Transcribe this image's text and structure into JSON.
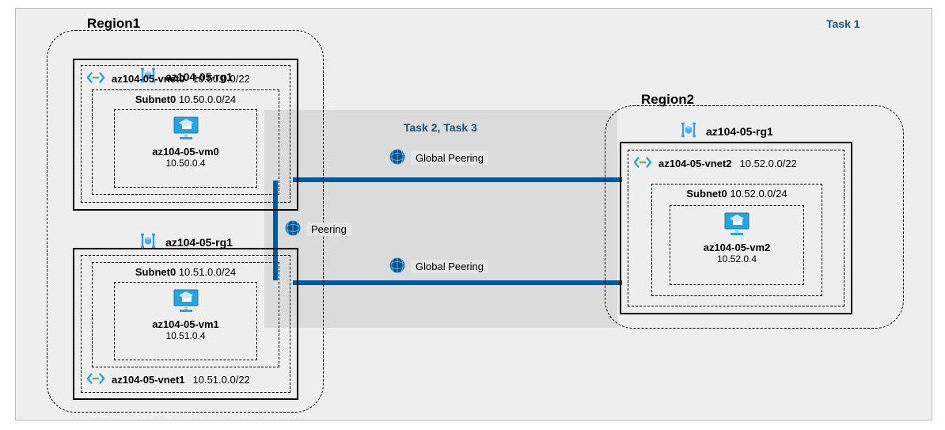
{
  "tasks": {
    "task1": "Task 1",
    "task23": "Task 2, Task 3"
  },
  "regions": {
    "r1": "Region1",
    "r2": "Region2"
  },
  "peering": {
    "local": "Peering",
    "global": "Global Peering"
  },
  "region1": {
    "rg_a": {
      "name": "az104-05-rg1",
      "vnet": {
        "name": "az104-05-vnet0",
        "cidr": "10.50.0.0/22"
      },
      "subnet": {
        "name": "Subnet0",
        "cidr": "10.50.0.0/24"
      },
      "vm": {
        "name": "az104-05-vm0",
        "ip": "10.50.0.4"
      }
    },
    "rg_b": {
      "name": "az104-05-rg1",
      "vnet": {
        "name": "az104-05-vnet1",
        "cidr": "10.51.0.0/22"
      },
      "subnet": {
        "name": "Subnet0",
        "cidr": "10.51.0.0/24"
      },
      "vm": {
        "name": "az104-05-vm1",
        "ip": "10.51.0.4"
      }
    }
  },
  "region2": {
    "rg": {
      "name": "az104-05-rg1",
      "vnet": {
        "name": "az104-05-vnet2",
        "cidr": "10.52.0.0/22"
      },
      "subnet": {
        "name": "Subnet0",
        "cidr": "10.52.0.0/24"
      },
      "vm": {
        "name": "az104-05-vm2",
        "ip": "10.52.0.4"
      }
    }
  }
}
